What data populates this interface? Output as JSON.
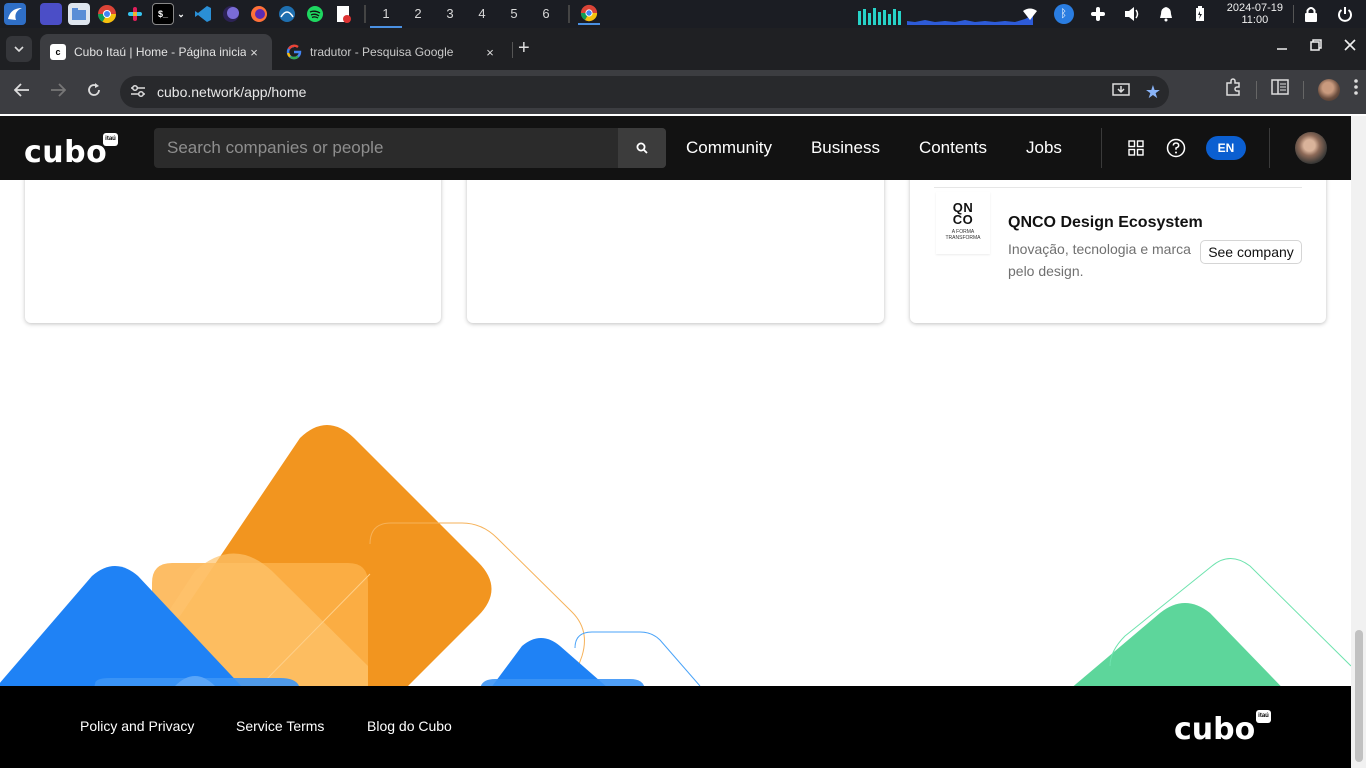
{
  "taskbar": {
    "workspaces": [
      "1",
      "2",
      "3",
      "4",
      "5",
      "6"
    ],
    "active_workspace": "1",
    "clock_date": "2024-07-19",
    "clock_time": "11:00",
    "apps": [
      "app-menu",
      "desktop",
      "files",
      "chrome",
      "slack",
      "terminal",
      "vscode",
      "eclipse",
      "firefox",
      "wireshark",
      "spotify",
      "document"
    ]
  },
  "browser": {
    "tabs": [
      {
        "title": "Cubo Itaú | Home - Página inicial",
        "favicon": "cubo-favicon",
        "active": true
      },
      {
        "title": "tradutor - Pesquisa Google",
        "favicon": "google-g-icon",
        "active": false
      }
    ],
    "close_glyph": "×",
    "new_tab_glyph": "+",
    "url": "cubo.network/app/home"
  },
  "site": {
    "logo_text": "cubo",
    "logo_badge": "itaú",
    "search_placeholder": "Search companies or people",
    "nav": [
      "Community",
      "Business",
      "Contents",
      "Jobs"
    ],
    "language": "EN"
  },
  "company_card": {
    "logo_mark": "QN\nCO",
    "logo_tagline": "A FORMA\nTRANSFORMA",
    "name": "QNCO Design Ecosystem",
    "description": "Inovação, tecnologia e marca pelo design.",
    "button": "See company"
  },
  "footer": {
    "links": [
      "Policy and Privacy",
      "Service Terms",
      "Blog do Cubo"
    ],
    "logo_text": "cubo",
    "logo_badge": "itaú"
  },
  "colors": {
    "header_bg": "#121212",
    "accent_blue": "#0b5fd1",
    "deco_orange": "#f2951f",
    "deco_blue": "#1f82f5",
    "deco_green": "#5dd69b"
  }
}
